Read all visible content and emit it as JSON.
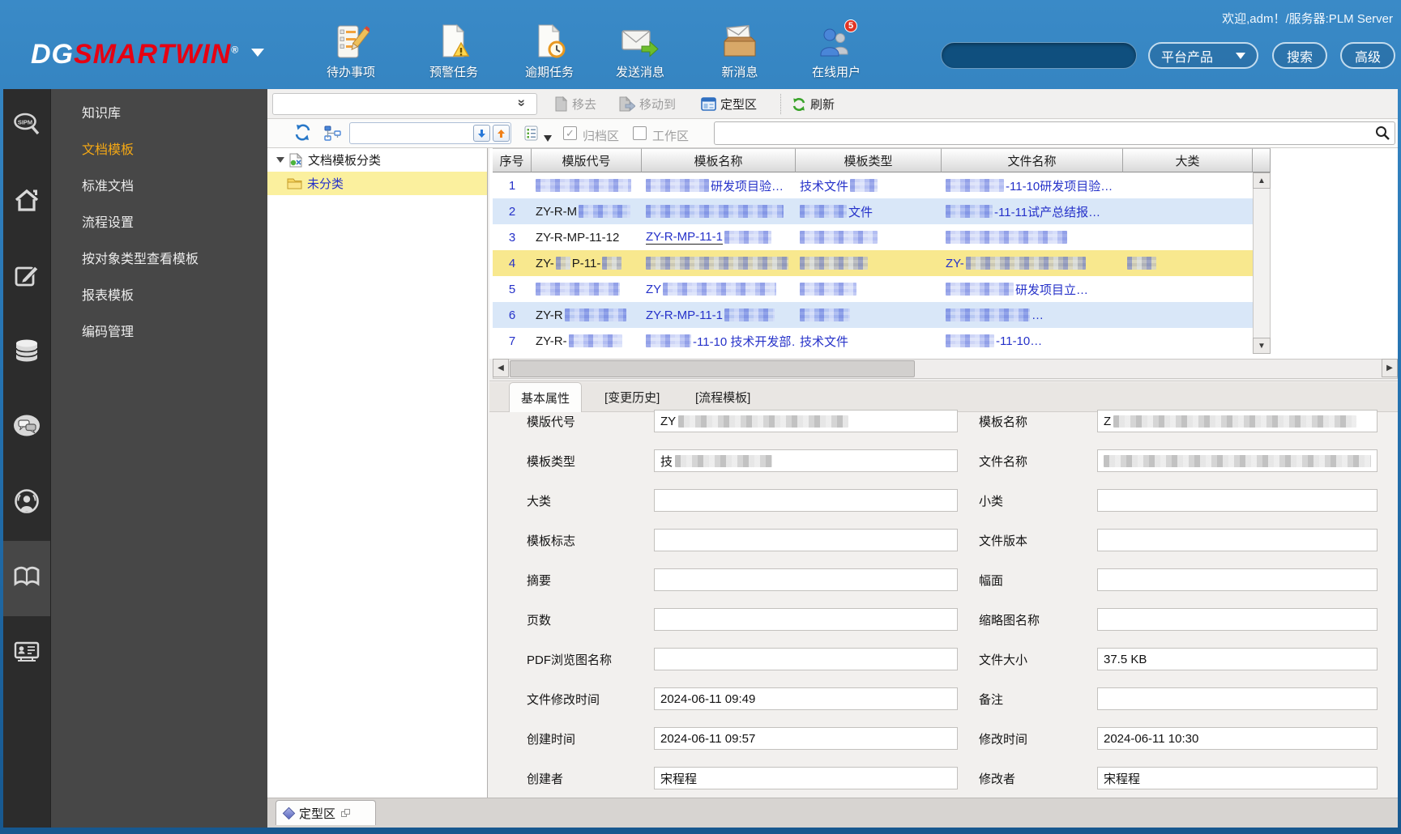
{
  "window": {
    "welcome": "欢迎,adm！/服务器:PLM Server"
  },
  "header": {
    "logo": {
      "dg": "DG",
      "brand": "SMARTWIN",
      "reg": "®"
    },
    "tools": [
      {
        "icon": "todo-list-icon",
        "label": "待办事项"
      },
      {
        "icon": "warning-task-icon",
        "label": "预警任务"
      },
      {
        "icon": "overdue-task-icon",
        "label": "逾期任务"
      },
      {
        "icon": "send-message-icon",
        "label": "发送消息"
      },
      {
        "icon": "new-message-icon",
        "label": "新消息"
      },
      {
        "icon": "online-users-icon",
        "label": "在线用户",
        "badge": "5"
      }
    ],
    "search": {
      "value": "",
      "scope": "平台产品",
      "search_label": "搜索",
      "advanced_label": "高级"
    }
  },
  "sidebar": {
    "rail": [
      {
        "icon": "sipm-search-icon"
      },
      {
        "icon": "home-icon"
      },
      {
        "icon": "edit-icon"
      },
      {
        "icon": "database-icon"
      },
      {
        "icon": "chat-icon"
      },
      {
        "icon": "broadcast-user-icon"
      },
      {
        "icon": "open-book-icon",
        "active": true
      },
      {
        "icon": "id-card-icon"
      }
    ],
    "menu": [
      {
        "label": "知识库",
        "active": false
      },
      {
        "label": "文档模板",
        "active": true
      },
      {
        "label": "标准文档",
        "active": false
      },
      {
        "label": "流程设置",
        "active": false
      },
      {
        "label": "按对象类型查看模板",
        "active": false
      },
      {
        "label": "报表模板",
        "active": false
      },
      {
        "label": "编码管理",
        "active": false
      }
    ]
  },
  "toolbar": {
    "move_out": "移去",
    "move_to": "移动到",
    "dingxing": "定型区",
    "refresh": "刷新",
    "archive_label": "归档区",
    "workspace_label": "工作区",
    "archive_checked": true,
    "workspace_checked": false
  },
  "tree": {
    "root": "文档模板分类",
    "child": "未分类"
  },
  "table": {
    "headers": [
      "序号",
      "模版代号",
      "模板名称",
      "模板类型",
      "文件名称",
      "大类"
    ],
    "rows": [
      {
        "num": "1",
        "cells": {
          "code": [
            {
              "b": 118
            }
          ],
          "name": [
            {
              "b": 78
            },
            {
              "t": "研发项目验…"
            }
          ],
          "type": [
            {
              "t": "技术文件"
            },
            {
              "b": 34
            }
          ],
          "file": [
            {
              "b": 72
            },
            {
              "t": "-11-10研发项目验…"
            }
          ],
          "cat": []
        }
      },
      {
        "num": "2",
        "cells": {
          "code": [
            {
              "t": "ZY-R-M"
            },
            {
              "b": 64
            }
          ],
          "name": [
            {
              "b": 170
            }
          ],
          "type": [
            {
              "b": 58
            },
            {
              "t": "文件"
            }
          ],
          "file": [
            {
              "b": 58
            },
            {
              "t": "-11-11试产总结报…"
            }
          ],
          "cat": []
        }
      },
      {
        "num": "3",
        "cells": {
          "code": [
            {
              "t": "ZY-R-MP-11-12"
            }
          ],
          "name": [
            {
              "t": "ZY-R-MP-11-1",
              "u": true
            },
            {
              "b": 58
            }
          ],
          "type": [
            {
              "b": 96
            }
          ],
          "file": [
            {
              "b": 150
            }
          ],
          "cat": []
        }
      },
      {
        "num": "4",
        "selected": true,
        "cells": {
          "code": [
            {
              "t": "ZY-"
            },
            {
              "b": 18
            },
            {
              "t": "P-11-"
            },
            {
              "b": 24
            }
          ],
          "name": [
            {
              "b": 176
            }
          ],
          "type": [
            {
              "b": 84
            }
          ],
          "file": [
            {
              "t": "ZY-"
            },
            {
              "b": 148
            }
          ],
          "cat": [
            {
              "b": 36
            }
          ]
        }
      },
      {
        "num": "5",
        "cells": {
          "code": [
            {
              "b": 104
            }
          ],
          "name": [
            {
              "t": "ZY"
            },
            {
              "b": 140
            }
          ],
          "type": [
            {
              "b": 70
            }
          ],
          "file": [
            {
              "b": 84
            },
            {
              "t": "研发项目立…"
            }
          ],
          "cat": []
        }
      },
      {
        "num": "6",
        "cells": {
          "code": [
            {
              "t": "ZY-R"
            },
            {
              "b": 76
            }
          ],
          "name": [
            {
              "t": "ZY-R-MP-11-1"
            },
            {
              "b": 62
            }
          ],
          "type": [
            {
              "b": 62
            }
          ],
          "file": [
            {
              "b": 104
            },
            {
              "t": "…"
            }
          ],
          "cat": []
        }
      },
      {
        "num": "7",
        "cells": {
          "code": [
            {
              "t": "ZY-R-"
            },
            {
              "b": 66
            }
          ],
          "name": [
            {
              "b": 56
            },
            {
              "t": "-11-10 技术开发部…"
            }
          ],
          "type": [
            {
              "t": "技术文件"
            }
          ],
          "file": [
            {
              "b": 60
            },
            {
              "t": "-11-10…"
            }
          ],
          "cat": []
        }
      }
    ]
  },
  "detail": {
    "tabs": [
      "基本属性",
      "[变更历史]",
      "[流程模板]"
    ],
    "left": [
      {
        "label": "模版代号",
        "value": "ZY",
        "censor": 210
      },
      {
        "label": "模板类型",
        "value": "技",
        "censor": 120
      },
      {
        "label": "大类",
        "value": ""
      },
      {
        "label": "模板标志",
        "value": ""
      },
      {
        "label": "摘要",
        "value": ""
      },
      {
        "label": "页数",
        "value": ""
      },
      {
        "label": "PDF浏览图名称",
        "value": ""
      },
      {
        "label": "文件修改时间",
        "value": "2024-06-11 09:49"
      },
      {
        "label": "创建时间",
        "value": "2024-06-11 09:57"
      },
      {
        "label": "创建者",
        "value": "宋程程"
      }
    ],
    "right": [
      {
        "label": "模板名称",
        "value": "Z",
        "censor": 300
      },
      {
        "label": "文件名称",
        "value": "",
        "censor": 330
      },
      {
        "label": "小类",
        "value": ""
      },
      {
        "label": "文件版本",
        "value": ""
      },
      {
        "label": "幅面",
        "value": ""
      },
      {
        "label": "缩略图名称",
        "value": ""
      },
      {
        "label": "文件大小",
        "value": "37.5 KB"
      },
      {
        "label": "备注",
        "value": ""
      },
      {
        "label": "修改时间",
        "value": "2024-06-11 10:30"
      },
      {
        "label": "修改者",
        "value": "宋程程"
      }
    ]
  },
  "bottom": {
    "tab": "定型区"
  },
  "colors": {
    "accent_blue": "#2573b1",
    "brand_red": "#e60012",
    "highlight_orange": "#f5a814",
    "selection_yellow": "#f8e88e",
    "link_blue": "#2531c9"
  }
}
